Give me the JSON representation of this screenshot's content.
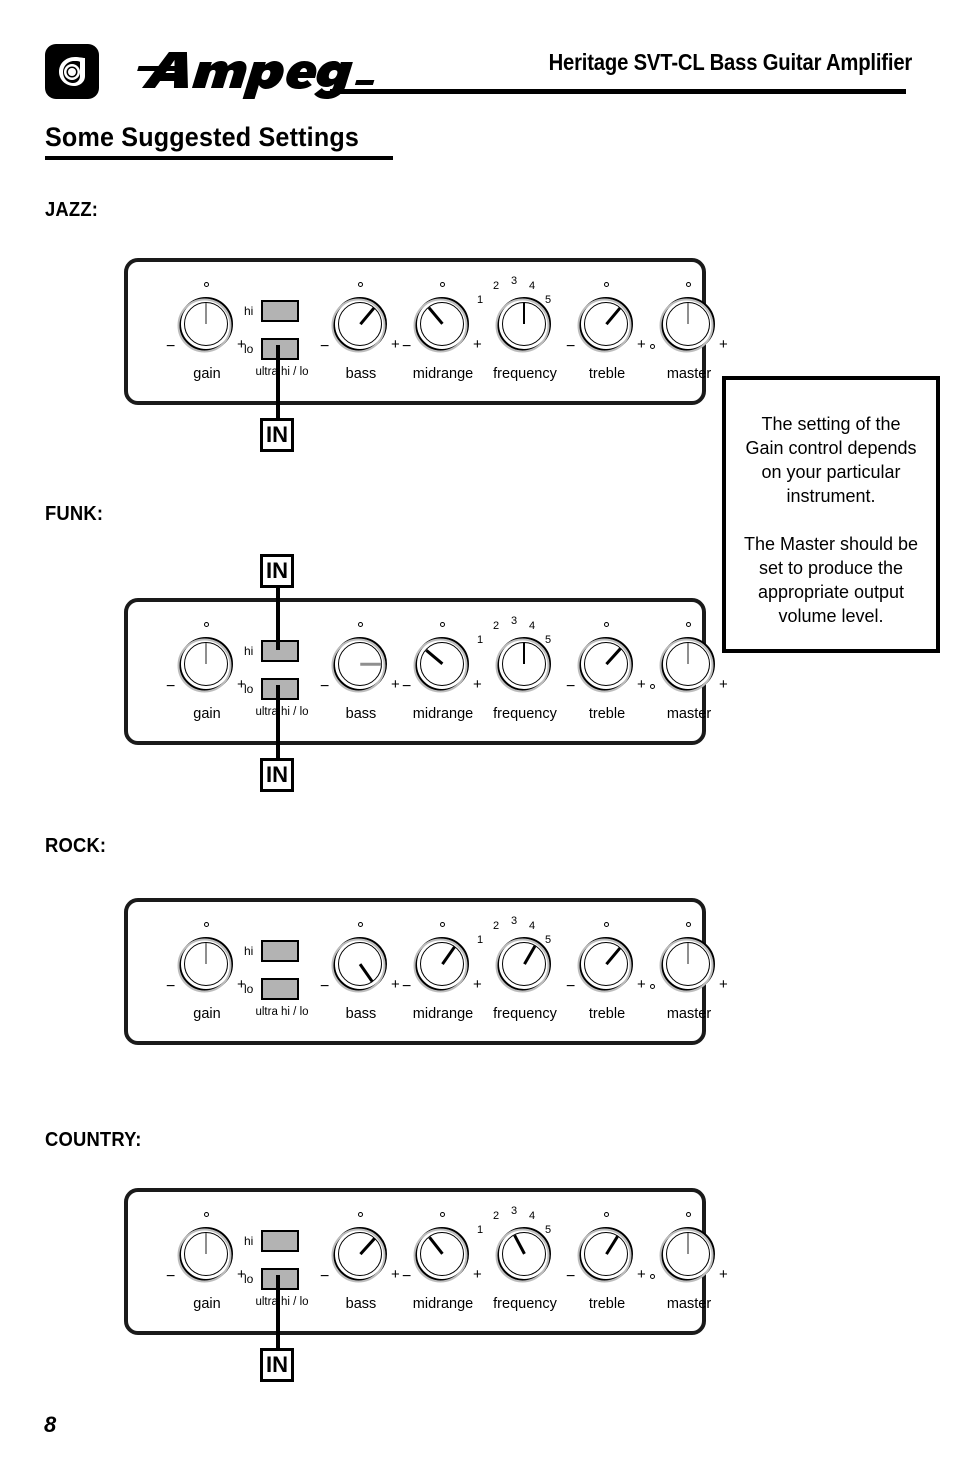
{
  "header": {
    "title": "Heritage SVT-CL Bass Guitar Amplifier",
    "logo_word": "Ampeg",
    "logo_mark": "ampeg-spiral-logo"
  },
  "page_title": "Some Suggested Settings",
  "page_number": "8",
  "note": {
    "paragraph1": "The setting of the Gain control depends on your particular instrument.",
    "paragraph2": "The Master should be set to produce the appropriate output volume level."
  },
  "knob_common": {
    "minus": "−",
    "plus": "+",
    "frequency_scale": [
      "1",
      "2",
      "3",
      "4",
      "5"
    ],
    "jack_hi": "hi",
    "jack_lo": "lo",
    "jack_caption": "ultra hi / lo",
    "in_label": "IN"
  },
  "colors": {
    "panel_border": "#1a1a1a",
    "jack_fill": "#b3b3b3",
    "knob_shadow": "#bdbdbd",
    "pointer_dark": "#000000",
    "pointer_light": "#8f8f8f"
  },
  "settings": [
    {
      "style": "JAZZ:",
      "cable": "below",
      "jack_plugged": "lo",
      "knobs": [
        {
          "label": "gain",
          "angle": 0,
          "pointer": "light",
          "marker": "o",
          "left_mark": "−",
          "right_mark": "+"
        },
        {
          "label": "bass",
          "angle": 40,
          "pointer": "dark",
          "marker": "o",
          "left_mark": "−",
          "right_mark": "+"
        },
        {
          "label": "midrange",
          "angle": -40,
          "pointer": "dark",
          "marker": "o",
          "left_mark": "−",
          "right_mark": "+"
        },
        {
          "label": "frequency",
          "angle": 0,
          "pointer": "dark",
          "marker": "scale",
          "left_mark": "",
          "right_mark": ""
        },
        {
          "label": "treble",
          "angle": 40,
          "pointer": "dark",
          "marker": "o",
          "left_mark": "−",
          "right_mark": "+"
        },
        {
          "label": "master",
          "angle": 0,
          "pointer": "light",
          "marker": "o",
          "left_mark": "circle",
          "right_mark": "+"
        }
      ]
    },
    {
      "style": "FUNK:",
      "cable": "above-and-below",
      "jack_plugged": "lo",
      "knobs": [
        {
          "label": "gain",
          "angle": 0,
          "pointer": "light",
          "marker": "o",
          "left_mark": "−",
          "right_mark": "+"
        },
        {
          "label": "bass",
          "angle": 90,
          "pointer": "light",
          "marker": "o",
          "left_mark": "−",
          "right_mark": "+"
        },
        {
          "label": "midrange",
          "angle": -50,
          "pointer": "dark",
          "marker": "o",
          "left_mark": "−",
          "right_mark": "+"
        },
        {
          "label": "frequency",
          "angle": 0,
          "pointer": "dark",
          "marker": "scale",
          "left_mark": "",
          "right_mark": ""
        },
        {
          "label": "treble",
          "angle": 42,
          "pointer": "dark",
          "marker": "o",
          "left_mark": "−",
          "right_mark": "+"
        },
        {
          "label": "master",
          "angle": 0,
          "pointer": "light",
          "marker": "o",
          "left_mark": "circle",
          "right_mark": "+"
        }
      ]
    },
    {
      "style": "ROCK:",
      "cable": "none",
      "jack_plugged": "none",
      "knobs": [
        {
          "label": "gain",
          "angle": 0,
          "pointer": "light",
          "marker": "o",
          "left_mark": "−",
          "right_mark": "+"
        },
        {
          "label": "bass",
          "angle": 145,
          "pointer": "dark",
          "marker": "o",
          "left_mark": "−",
          "right_mark": "+"
        },
        {
          "label": "midrange",
          "angle": 35,
          "pointer": "dark",
          "marker": "o",
          "left_mark": "−",
          "right_mark": "+"
        },
        {
          "label": "frequency",
          "angle": 30,
          "pointer": "dark",
          "marker": "scale",
          "left_mark": "",
          "right_mark": ""
        },
        {
          "label": "treble",
          "angle": 40,
          "pointer": "dark",
          "marker": "o",
          "left_mark": "−",
          "right_mark": "+"
        },
        {
          "label": "master",
          "angle": 0,
          "pointer": "light",
          "marker": "o",
          "left_mark": "circle",
          "right_mark": "+"
        }
      ]
    },
    {
      "style": "COUNTRY:",
      "cable": "below",
      "jack_plugged": "lo",
      "knobs": [
        {
          "label": "gain",
          "angle": 0,
          "pointer": "light",
          "marker": "o",
          "left_mark": "−",
          "right_mark": "+"
        },
        {
          "label": "bass",
          "angle": 42,
          "pointer": "dark",
          "marker": "o",
          "left_mark": "−",
          "right_mark": "+"
        },
        {
          "label": "midrange",
          "angle": -38,
          "pointer": "dark",
          "marker": "o",
          "left_mark": "−",
          "right_mark": "+"
        },
        {
          "label": "frequency",
          "angle": -28,
          "pointer": "dark",
          "marker": "scale",
          "left_mark": "",
          "right_mark": ""
        },
        {
          "label": "treble",
          "angle": 32,
          "pointer": "dark",
          "marker": "o",
          "left_mark": "−",
          "right_mark": "+"
        },
        {
          "label": "master",
          "angle": 0,
          "pointer": "light",
          "marker": "o",
          "left_mark": "circle",
          "right_mark": "+"
        }
      ]
    }
  ]
}
